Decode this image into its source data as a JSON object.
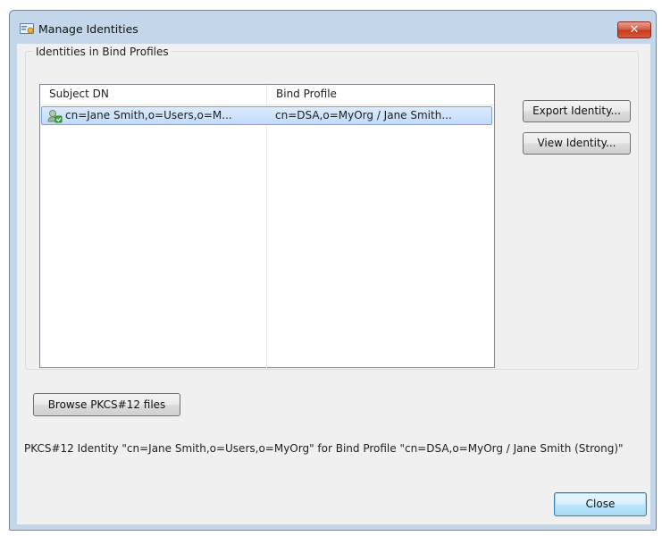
{
  "window": {
    "title": "Manage Identities",
    "close_glyph": "✕"
  },
  "group": {
    "label": "Identities in Bind Profiles"
  },
  "table": {
    "columns": [
      "Subject DN",
      "Bind Profile"
    ],
    "rows": [
      {
        "subject_dn": "cn=Jane Smith,o=Users,o=M...",
        "bind_profile": "cn=DSA,o=MyOrg / Jane Smith...",
        "icon": "certificate-identity-icon",
        "selected": true
      }
    ]
  },
  "buttons": {
    "export_identity": "Export Identity...",
    "view_identity": "View Identity...",
    "browse_pkcs12": "Browse PKCS#12 files",
    "close": "Close"
  },
  "status": {
    "text": "PKCS#12 Identity \"cn=Jane Smith,o=Users,o=MyOrg\" for Bind Profile \"cn=DSA,o=MyOrg / Jane Smith (Strong)\""
  },
  "colors": {
    "window_frame": "#c4d6ea",
    "client_bg": "#f0f0f0",
    "selection": "#c1dbfc",
    "close_button": "#c43a20"
  }
}
